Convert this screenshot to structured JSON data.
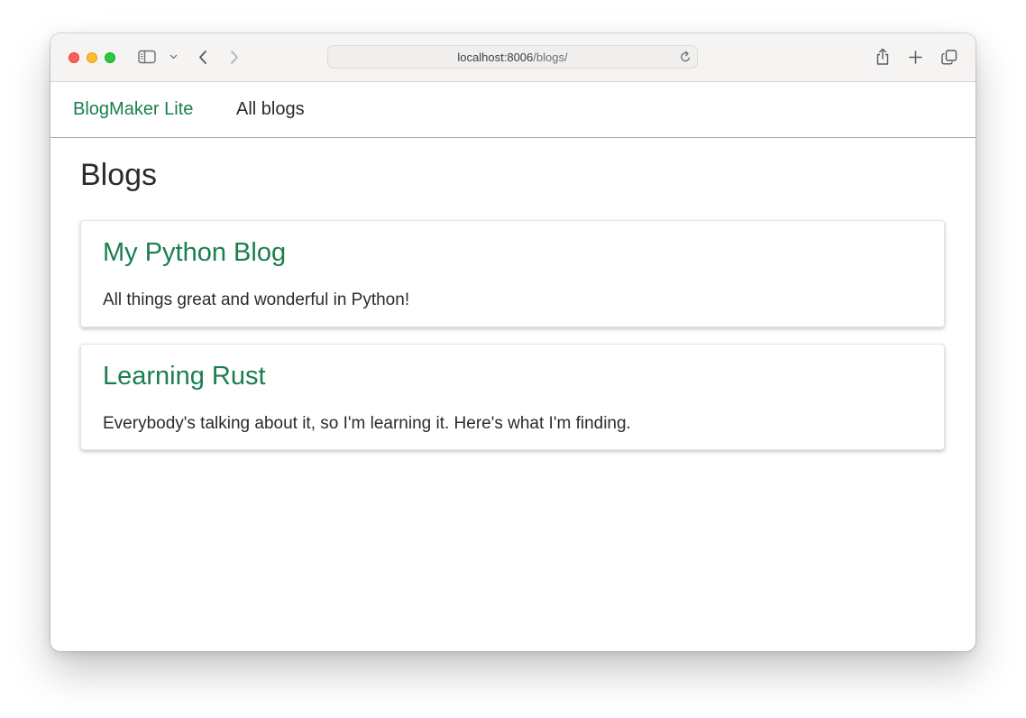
{
  "browser": {
    "address_host": "localhost:8006",
    "address_path": "/blogs/"
  },
  "navbar": {
    "brand": "BlogMaker Lite",
    "links": [
      {
        "label": "All blogs"
      }
    ]
  },
  "page": {
    "title": "Blogs"
  },
  "blogs": [
    {
      "title": "My Python Blog",
      "description": "All things great and wonderful in Python!"
    },
    {
      "title": "Learning Rust",
      "description": "Everybody's talking about it, so I'm learning it. Here's what I'm finding."
    }
  ],
  "colors": {
    "accent_green": "#1a7f4e",
    "text_dark": "#2b2b2b",
    "toolbar_bg": "#f5f4f3"
  },
  "icons": {
    "window_controls": [
      "close-button",
      "minimize-button",
      "zoom-button"
    ],
    "toolbar": [
      "sidebar-icon",
      "chevron-down-icon",
      "back-icon",
      "forward-icon",
      "reload-icon",
      "share-icon",
      "plus-icon",
      "tabs-overview-icon"
    ]
  }
}
